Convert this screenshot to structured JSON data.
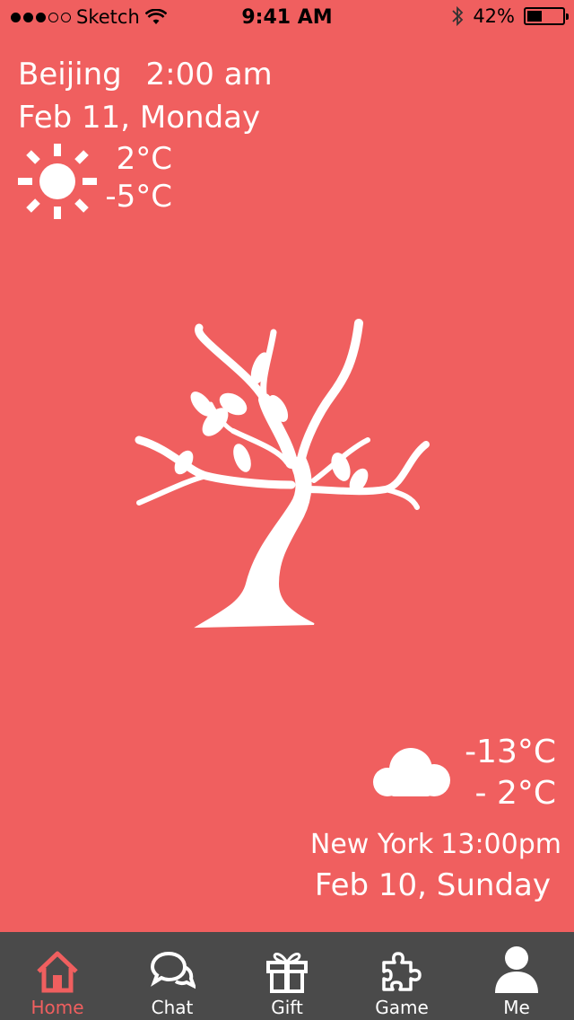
{
  "status_bar": {
    "carrier": "Sketch",
    "time": "9:41 AM",
    "battery": "42%",
    "battery_level": 0.42
  },
  "beijing": {
    "city": "Beijing",
    "time": "2:00 am",
    "date": "Feb 11, Monday",
    "icon": "sun-icon",
    "high": "2°C",
    "low": "-5°C"
  },
  "new_york": {
    "icon": "cloud-icon",
    "high": "-13°C",
    "low": "- 2°C",
    "city": "New York",
    "time": "13:00pm",
    "date": "Feb 10, Sunday"
  },
  "tabs": [
    {
      "label": "Home",
      "icon": "home-icon",
      "active": true
    },
    {
      "label": "Chat",
      "icon": "chat-icon",
      "active": false
    },
    {
      "label": "Gift",
      "icon": "gift-icon",
      "active": false
    },
    {
      "label": "Game",
      "icon": "puzzle-icon",
      "active": false
    },
    {
      "label": "Me",
      "icon": "user-icon",
      "active": false
    }
  ],
  "colors": {
    "background": "#F05F5F",
    "tab_bar": "#4A4A4A",
    "active_tab": "#F05F5F"
  }
}
